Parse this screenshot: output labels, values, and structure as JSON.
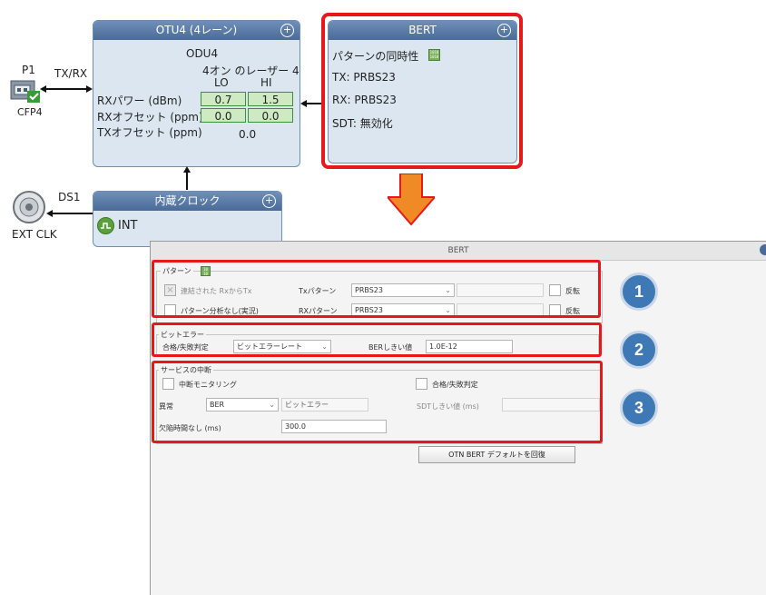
{
  "ports": {
    "p1_label": "P1",
    "p1_type": "CFP4",
    "txrx_label": "TX/RX",
    "ds1_label": "DS1",
    "ext_clk_label": "EXT CLK"
  },
  "otu4": {
    "title": "OTU4 (4レーン)",
    "odu": "ODU4",
    "lasers": "4オン のレーザー 4",
    "col_lo": "LO",
    "col_hi": "HI",
    "rx_power_label": "RXパワー (dBm)",
    "rx_power_lo": "0.7",
    "rx_power_hi": "1.5",
    "rx_offset_label": "RXオフセット (ppm)",
    "rx_offset_lo": "0.0",
    "rx_offset_hi": "0.0",
    "tx_offset_label": "TXオフセット (ppm)",
    "tx_offset_value": "0.0"
  },
  "bert_block": {
    "title": "BERT",
    "pattern_sync": "パターンの同時性",
    "tx": "TX: PRBS23",
    "rx": "RX: PRBS23",
    "sdt": "SDT: 無効化"
  },
  "clock": {
    "title": "内蔵クロック",
    "value": "INT"
  },
  "bert_panel": {
    "title": "BERT",
    "pattern_group": "パターン",
    "coupled_label": "連結された RxからTx",
    "no_analysis_label": "パターン分析なし(実況)",
    "tx_pattern_label": "Txパターン",
    "tx_pattern_value": "PRBS23",
    "rx_pattern_label": "RXパターン",
    "rx_pattern_value": "PRBS23",
    "invert_label": "反転",
    "bit_error_group": "ビットエラー",
    "pass_fail_label": "合格/失敗判定",
    "pass_fail_value": "ビットエラーレート",
    "ber_threshold_label": "BERしきい値",
    "ber_threshold_value": "1.0E-12",
    "disruption_group": "サービスの中断",
    "disruption_monitoring_label": "中断モニタリング",
    "disruption_pass_fail_label": "合格/失敗判定",
    "anomaly_label": "異常",
    "anomaly_value": "BER",
    "anomaly_field": "ビットエラー",
    "sdt_threshold_label": "SDTしきい値 (ms)",
    "no_defect_label": "欠陥時間なし (ms)",
    "no_defect_value": "300.0",
    "restore_button": "OTN BERT デフォルトを回復"
  },
  "callouts": [
    "1",
    "2",
    "3"
  ],
  "colors": {
    "highlight": "#e8171b",
    "callout": "#3f79b5",
    "arrow": "#f08a24",
    "block_header": "#4a6b98"
  }
}
